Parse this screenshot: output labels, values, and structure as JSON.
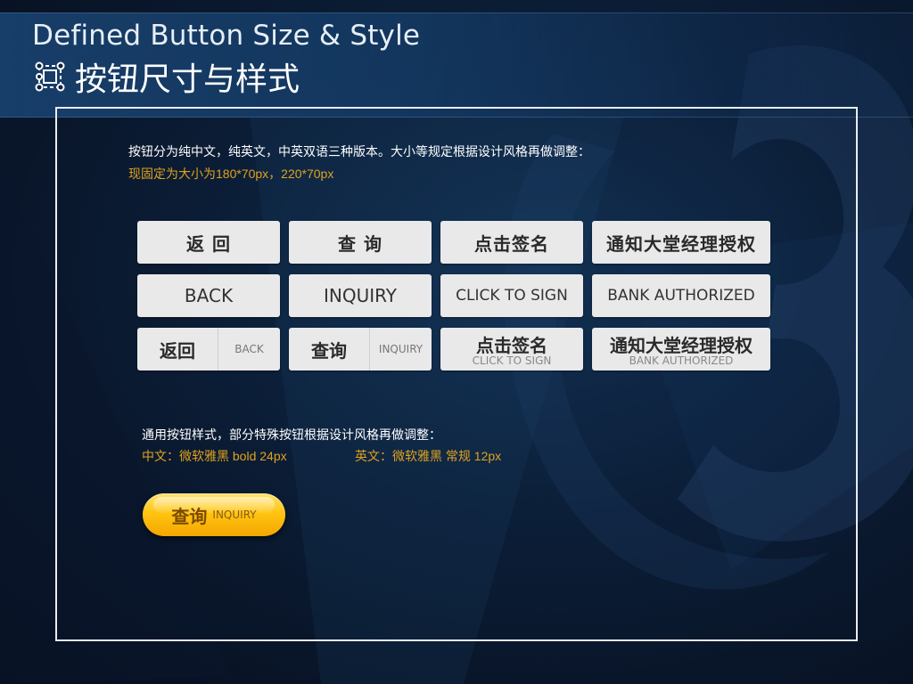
{
  "header": {
    "title_en": "Defined Button Size & Style",
    "title_cn": "按钮尺寸与样式",
    "icon": "selection-box-icon"
  },
  "description": {
    "line1": "按钮分为纯中文，纯英文，中英双语三种版本。大小等规定根据设计风格再做调整：",
    "line2": "现固定为大小为180*70px，220*70px"
  },
  "buttons": {
    "cn": [
      "返 回",
      "查 询",
      "点击签名",
      "通知大堂经理授权"
    ],
    "en": [
      "BACK",
      "INQUIRY",
      "CLICK TO SIGN",
      "BANK AUTHORIZED"
    ],
    "bilingual": [
      {
        "cn": "返回",
        "en": "BACK"
      },
      {
        "cn": "查询",
        "en": "INQUIRY"
      },
      {
        "cn": "点击签名",
        "en": "CLICK TO SIGN"
      },
      {
        "cn": "通知大堂经理授权",
        "en": "BANK  AUTHORIZED"
      }
    ]
  },
  "style_note": {
    "general": "通用按钮样式，部分特殊按钮根据设计风格再做调整：",
    "cn_font": "中文：微软雅黑 bold 24px",
    "en_font": "英文：微软雅黑 常规 12px"
  },
  "sample_button": {
    "cn": "查询",
    "en": "INQUIRY"
  },
  "colors": {
    "accent": "#e0a21e",
    "button_bg": "#e9e9ea",
    "frame": "#e8edf2",
    "sample_button": "#ffc512"
  }
}
